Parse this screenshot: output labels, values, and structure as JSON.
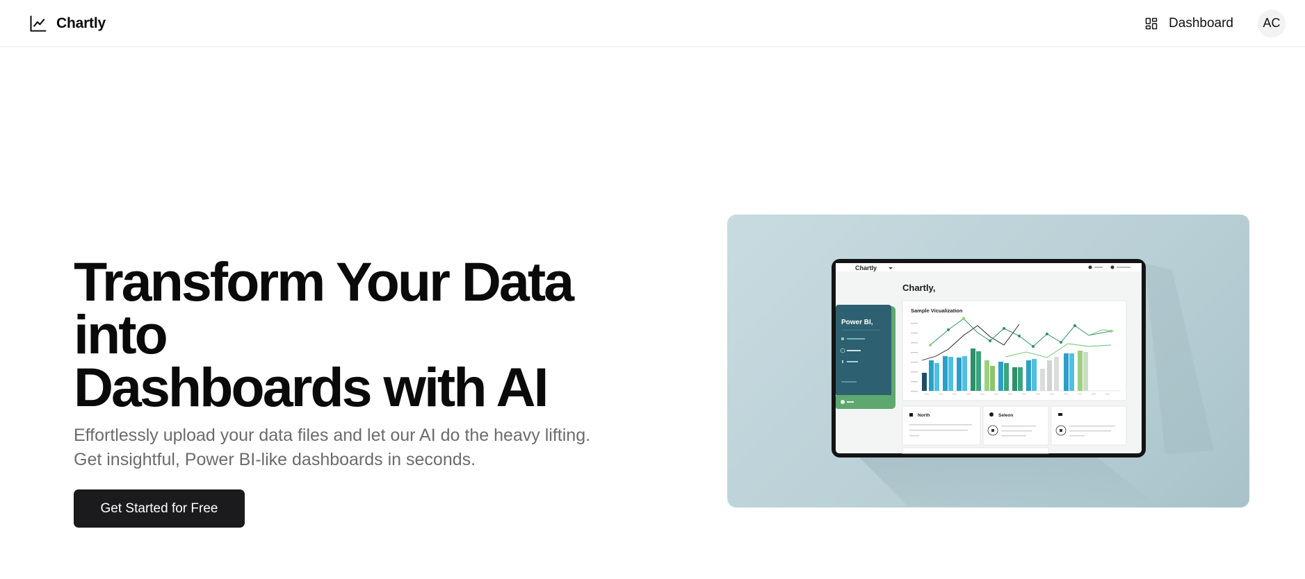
{
  "nav": {
    "brand": "Chartly",
    "brand_icon": "line-chart-icon",
    "dashboard_label": "Dashboard",
    "dashboard_icon": "layout-grid-icon",
    "avatar_initials": "AC"
  },
  "hero": {
    "title_line1": "Transform Your Data into",
    "title_line2": "Dashboards with AI",
    "subtitle": "Effortlessly upload your data files and let our AI do the heavy lifting. Get insightful, Power BI-like dashboards in seconds.",
    "cta_label": "Get Started for Free"
  },
  "mockup": {
    "app_name": "Chartly",
    "title": "Chartly,",
    "sidebar_title": "Power BI,",
    "chart_title": "Sample Vicualization",
    "card_labels": [
      "North",
      "Seleon"
    ]
  },
  "colors": {
    "cta_bg": "#1b1b1d",
    "headline": "#0a0a0a",
    "subtitle": "#6b6b70",
    "image_bg": "#c3d8dd",
    "sidebar_teal": "#2d6070",
    "sidebar_green": "#5ea86f"
  }
}
